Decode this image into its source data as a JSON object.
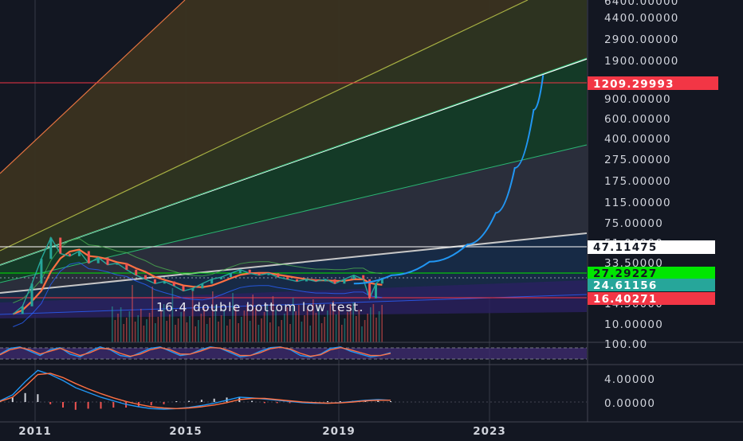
{
  "chart_data": [
    {
      "type": "line",
      "title": "",
      "scale": "log",
      "grid": true,
      "x_ticks": [
        "2011",
        "2015",
        "2019",
        "2023"
      ],
      "y_ticks": [
        "6400.00000",
        "4400.00000",
        "2900.00000",
        "1900.00000",
        "900.00000",
        "600.00000",
        "400.00000",
        "275.00000",
        "175.00000",
        "115.00000",
        "75.00000",
        "51.00000",
        "33.50000",
        "14.50000",
        "10.00000",
        "100.00"
      ],
      "price_labels": [
        {
          "name": "resistance",
          "label": "1209.29993",
          "value": 1209.29993,
          "color": "#f23645",
          "text_color": "#ffffff"
        },
        {
          "name": "upper-trend",
          "label": "47.11475",
          "value": 47.11475,
          "color": "#ffffff",
          "text_color": "#131722"
        },
        {
          "name": "ma",
          "label": "27.29227",
          "value": 27.29227,
          "color": "#00e600",
          "text_color": "#131722"
        },
        {
          "name": "last-price",
          "label": "24.61156",
          "value": 24.61156,
          "color": "#26a69a",
          "text_color": "#ffffff"
        },
        {
          "name": "support",
          "label": "16.40271",
          "value": 16.40271,
          "color": "#f23645",
          "text_color": "#ffffff"
        }
      ],
      "annotations": [
        {
          "text": "16.4 double bottom low test.",
          "x": "2017-04",
          "y": 14.5
        }
      ],
      "projected_path": [
        {
          "x": "2019-06",
          "y": 22
        },
        {
          "x": "2020-06",
          "y": 26
        },
        {
          "x": "2021-06",
          "y": 34
        },
        {
          "x": "2022-06",
          "y": 48
        },
        {
          "x": "2023-03",
          "y": 90
        },
        {
          "x": "2023-09",
          "y": 220
        },
        {
          "x": "2024-03",
          "y": 700
        },
        {
          "x": "2024-06",
          "y": 1400
        }
      ],
      "price_series": [
        {
          "x": "2010-06",
          "y": 12
        },
        {
          "x": "2010-09",
          "y": 14
        },
        {
          "x": "2010-12",
          "y": 22
        },
        {
          "x": "2011-03",
          "y": 36
        },
        {
          "x": "2011-06",
          "y": 55
        },
        {
          "x": "2011-09",
          "y": 40
        },
        {
          "x": "2011-12",
          "y": 38
        },
        {
          "x": "2012-03",
          "y": 42
        },
        {
          "x": "2012-06",
          "y": 33
        },
        {
          "x": "2012-09",
          "y": 37
        },
        {
          "x": "2012-12",
          "y": 32
        },
        {
          "x": "2013-03",
          "y": 33
        },
        {
          "x": "2013-06",
          "y": 29
        },
        {
          "x": "2013-09",
          "y": 26
        },
        {
          "x": "2013-12",
          "y": 24
        },
        {
          "x": "2014-03",
          "y": 22
        },
        {
          "x": "2014-06",
          "y": 23
        },
        {
          "x": "2014-09",
          "y": 21
        },
        {
          "x": "2014-12",
          "y": 19
        },
        {
          "x": "2015-03",
          "y": 20
        },
        {
          "x": "2015-06",
          "y": 22
        },
        {
          "x": "2015-09",
          "y": 24
        },
        {
          "x": "2015-12",
          "y": 25
        },
        {
          "x": "2016-03",
          "y": 27
        },
        {
          "x": "2016-06",
          "y": 29
        },
        {
          "x": "2016-09",
          "y": 27
        },
        {
          "x": "2016-12",
          "y": 26
        },
        {
          "x": "2017-03",
          "y": 27
        },
        {
          "x": "2017-06",
          "y": 25
        },
        {
          "x": "2017-09",
          "y": 24
        },
        {
          "x": "2017-12",
          "y": 23
        },
        {
          "x": "2018-03",
          "y": 24
        },
        {
          "x": "2018-06",
          "y": 23
        },
        {
          "x": "2018-09",
          "y": 24
        },
        {
          "x": "2018-12",
          "y": 22
        },
        {
          "x": "2019-03",
          "y": 24
        },
        {
          "x": "2019-06",
          "y": 26
        },
        {
          "x": "2019-09",
          "y": 24
        },
        {
          "x": "2019-11",
          "y": 16.4
        },
        {
          "x": "2020-01",
          "y": 22
        },
        {
          "x": "2020-03",
          "y": 24.6
        }
      ]
    },
    {
      "type": "line",
      "name": "stochastic",
      "y_ticks": [
        "100.00"
      ],
      "series": [
        {
          "name": "k",
          "color": "#2196f3",
          "values": [
            40,
            80,
            90,
            60,
            30,
            70,
            85,
            40,
            20,
            60,
            90,
            70,
            30,
            20,
            50,
            80,
            90,
            60,
            30,
            40,
            70,
            90,
            80,
            50,
            20,
            30,
            60,
            85,
            90,
            70,
            30,
            20,
            40,
            80,
            90,
            60,
            40,
            20,
            30,
            50
          ]
        },
        {
          "name": "d",
          "color": "#ff7043",
          "values": [
            35,
            70,
            85,
            70,
            40,
            60,
            80,
            55,
            30,
            50,
            80,
            75,
            45,
            25,
            40,
            70,
            85,
            70,
            40,
            40,
            60,
            85,
            82,
            60,
            30,
            30,
            50,
            78,
            88,
            75,
            45,
            25,
            35,
            70,
            85,
            70,
            50,
            30,
            30,
            45
          ]
        }
      ]
    },
    {
      "type": "bar",
      "name": "macd",
      "y_ticks": [
        "4.00000",
        "0.00000"
      ],
      "series": [
        {
          "name": "macd",
          "color": "#2196f3",
          "values": [
            0.2,
            1.2,
            3.4,
            5.3,
            4.6,
            3.6,
            2.4,
            1.6,
            0.8,
            0.2,
            -0.4,
            -0.8,
            -1.1,
            -1.2,
            -1.1,
            -0.9,
            -0.6,
            -0.2,
            0.3,
            0.8,
            0.7,
            0.5,
            0.3,
            0.1,
            -0.1,
            -0.2,
            -0.2,
            -0.1,
            0.1,
            0.3,
            0.4,
            0.3
          ]
        },
        {
          "name": "signal",
          "color": "#ff7043",
          "values": [
            0.1,
            0.8,
            2.6,
            4.6,
            4.8,
            4.1,
            3.1,
            2.2,
            1.4,
            0.7,
            0.1,
            -0.4,
            -0.8,
            -1.0,
            -1.1,
            -1.0,
            -0.8,
            -0.5,
            -0.1,
            0.4,
            0.6,
            0.6,
            0.4,
            0.2,
            0.0,
            -0.1,
            -0.2,
            -0.15,
            0.0,
            0.2,
            0.3,
            0.3
          ]
        }
      ]
    }
  ]
}
